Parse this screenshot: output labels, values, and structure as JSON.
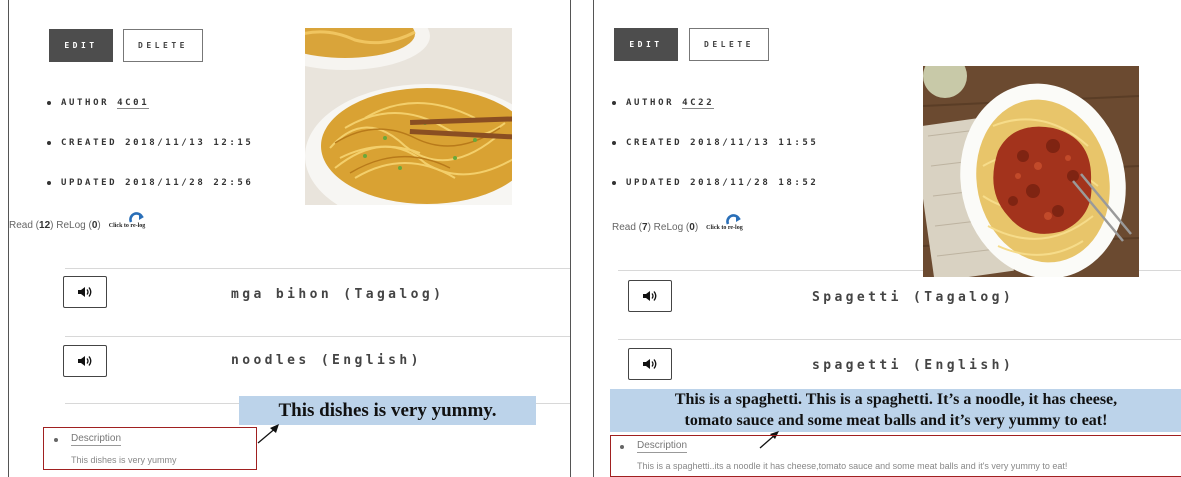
{
  "left": {
    "buttons": {
      "edit": "EDIT",
      "delete": "DELETE"
    },
    "meta": {
      "author_label": "AUTHOR ",
      "author_value": "4C01",
      "created": "CREATED 2018/11/13 12:15",
      "updated": "UPDATED 2018/11/28 22:56"
    },
    "stats": {
      "read_label": "Read (",
      "read_count": "12",
      "relog_label": ") ReLog (",
      "relog_count": "0",
      "close": ")",
      "relog_button": "Click to re-log"
    },
    "words": [
      {
        "text": "mga bihon (Tagalog)"
      },
      {
        "text": "noodles (English)"
      }
    ],
    "callout": "This dishes is very yummy.",
    "description": {
      "label": "Description",
      "text": "This dishes is very yummy"
    }
  },
  "right": {
    "buttons": {
      "edit": "EDIT",
      "delete": "DELETE"
    },
    "meta": {
      "author_label": "AUTHOR ",
      "author_value": "4C22",
      "created": "CREATED 2018/11/13 11:55",
      "updated": "UPDATED 2018/11/28 18:52"
    },
    "stats": {
      "read_label": "Read (",
      "read_count": "7",
      "relog_label": ") ReLog (",
      "relog_count": "0",
      "close": ")",
      "relog_button": "Click to re-log"
    },
    "words": [
      {
        "text": "Spagetti (Tagalog)"
      },
      {
        "text": "spagetti (English)"
      }
    ],
    "callout_lines": [
      "This is a spaghetti. This is a spaghetti. It’s a noodle, it has cheese,",
      "tomato sauce and some meat balls and it’s very yummy to eat!"
    ],
    "description": {
      "label": "Description",
      "text": "This is a spaghetti..its a noodle it has cheese,tomato sauce and some meat balls and it's very yummy to eat!"
    }
  },
  "icons": {
    "speaker": "speaker-icon",
    "refresh": "refresh-icon",
    "arrow": "callout-arrow-icon"
  },
  "colors": {
    "callout_bg": "#bcd3ea",
    "desc_border": "#a02020",
    "edit_bg": "#4d4d4d"
  }
}
